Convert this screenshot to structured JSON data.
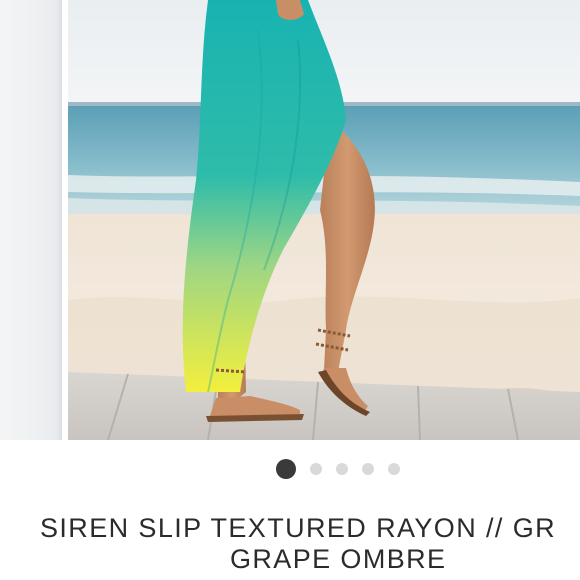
{
  "product": {
    "title_line1": "SIREN SLIP TEXTURED RAYON // GR",
    "title_line2": "GRAPE OMBRE"
  },
  "gallery": {
    "slide_count": 5,
    "active_index": 0
  },
  "colors": {
    "active_dot": "#3a3a3a",
    "inactive_dot": "#d9d9d9",
    "title_text": "#2b2b2b",
    "dress_top": "#1fb5b0",
    "dress_bottom": "#f2ef3b"
  }
}
